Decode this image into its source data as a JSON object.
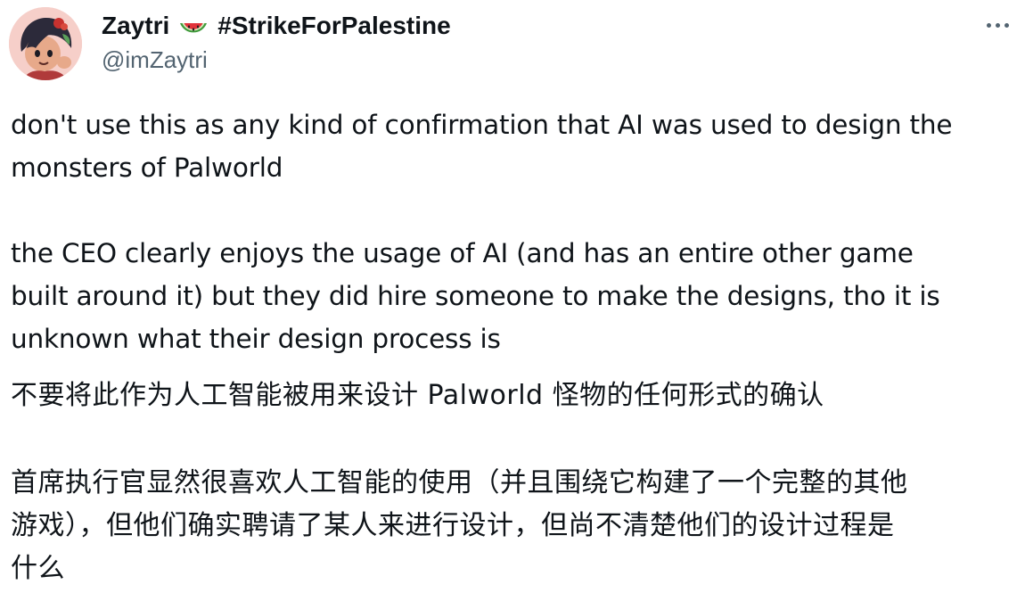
{
  "author": {
    "display_name": "Zaytri",
    "emoji": "🍉",
    "hashtag": "#StrikeForPalestine",
    "handle": "@imZaytri"
  },
  "tweet": {
    "en_paragraph_1": [
      "don't use this as any kind of confirmation that AI was used to design the",
      "monsters of Palworld"
    ],
    "en_paragraph_2": [
      "the CEO clearly enjoys the usage of AI (and has an entire other game",
      "built around it) but they did hire someone to make the designs, tho it is",
      "unknown what their design process is"
    ],
    "zh_paragraph_1": [
      "不要将此作为人工智能被用来设计 Palworld 怪物的任何形式的确认"
    ],
    "zh_paragraph_2": [
      "首席执行官显然很喜欢人工智能的使用（并且围绕它构建了一个完整的其他",
      "游戏），但他们确实聘请了某人来进行设计，但尚不清楚他们的设计过程是",
      "什么"
    ]
  },
  "icons": {
    "more": "more-dots-icon",
    "watermelon": "watermelon-emoji"
  }
}
